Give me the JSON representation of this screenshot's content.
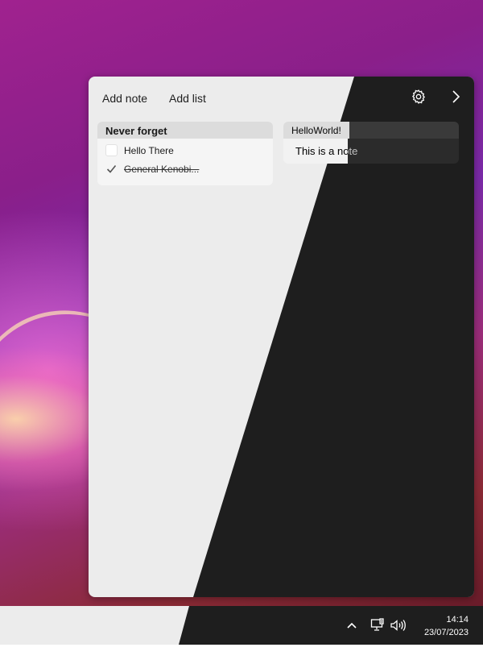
{
  "toolbar": {
    "add_note": "Add note",
    "add_list": "Add list",
    "settings_icon": "gear-icon",
    "expand_icon": "chevron-right-icon"
  },
  "list": {
    "title": "Never forget",
    "items": [
      {
        "text": "Hello There",
        "checked": false
      },
      {
        "text": "General Kenobi...",
        "checked": true
      }
    ]
  },
  "note": {
    "title": "HelloWorld!",
    "body": "This is a note"
  },
  "taskbar": {
    "time": "14:14",
    "date": "23/07/2023",
    "icons": [
      "chevron-up-icon",
      "network-icon",
      "volume-icon"
    ]
  },
  "colors": {
    "light_surface": "#ececec",
    "dark_surface": "#1e1e1e"
  }
}
